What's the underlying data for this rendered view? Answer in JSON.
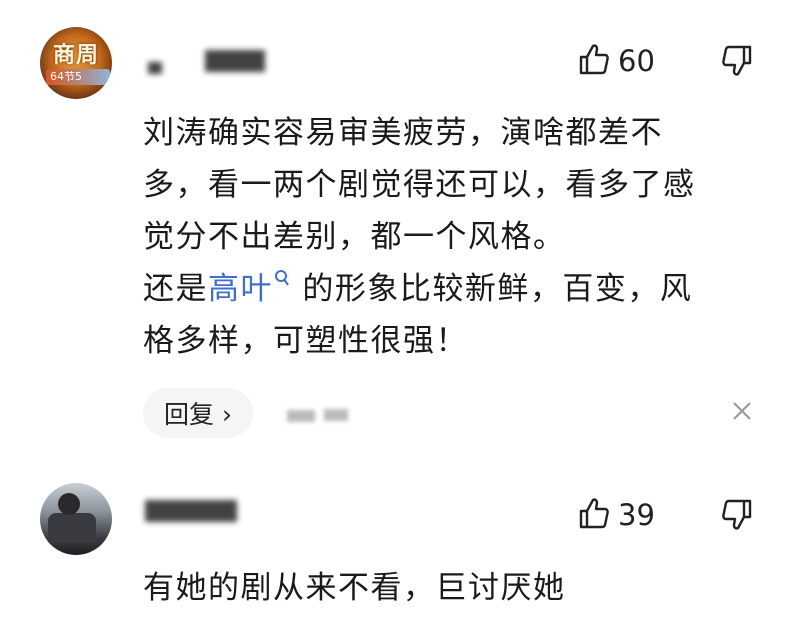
{
  "comments": [
    {
      "avatar_text": "商周",
      "avatar_sub": "64节5",
      "likes": "60",
      "lines": [
        "刘涛确实容易审美疲劳，演啥都差不",
        "多，看一两个剧觉得还可以，看多了感",
        "觉分不出差别，都一个风格。"
      ],
      "line4_prefix": "还是",
      "line4_link": "高叶",
      "line4_suffix": " 的形象比较新鲜，百变，风",
      "line5": "格多样，可塑性很强！",
      "reply_label": "回复 ›"
    },
    {
      "likes": "39",
      "lines": [
        "有她的剧从来不看，巨讨厌她"
      ]
    }
  ],
  "icons": {
    "like": "thumbs-up-icon",
    "dislike": "thumbs-down-icon",
    "search": "search-icon",
    "close": "close-icon"
  },
  "colors": {
    "link": "#3f6fd0",
    "reply_bg": "#f4f5f7"
  }
}
